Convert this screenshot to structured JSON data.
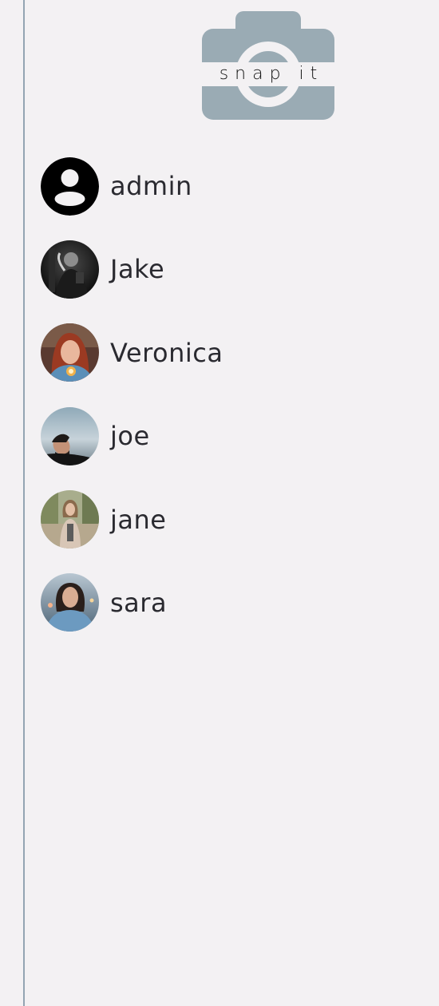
{
  "app": {
    "logo_text": "snap it",
    "logo_icon": "camera-icon",
    "colors": {
      "background": "#f3f1f3",
      "logo": "#9aabb4",
      "border": "#93a4b2",
      "text": "#2a2a30"
    }
  },
  "users": [
    {
      "name": "admin",
      "avatar": "default-user-icon"
    },
    {
      "name": "Jake",
      "avatar": "photo"
    },
    {
      "name": "Veronica",
      "avatar": "photo"
    },
    {
      "name": "joe",
      "avatar": "photo"
    },
    {
      "name": "jane",
      "avatar": "photo"
    },
    {
      "name": "sara",
      "avatar": "photo"
    }
  ]
}
